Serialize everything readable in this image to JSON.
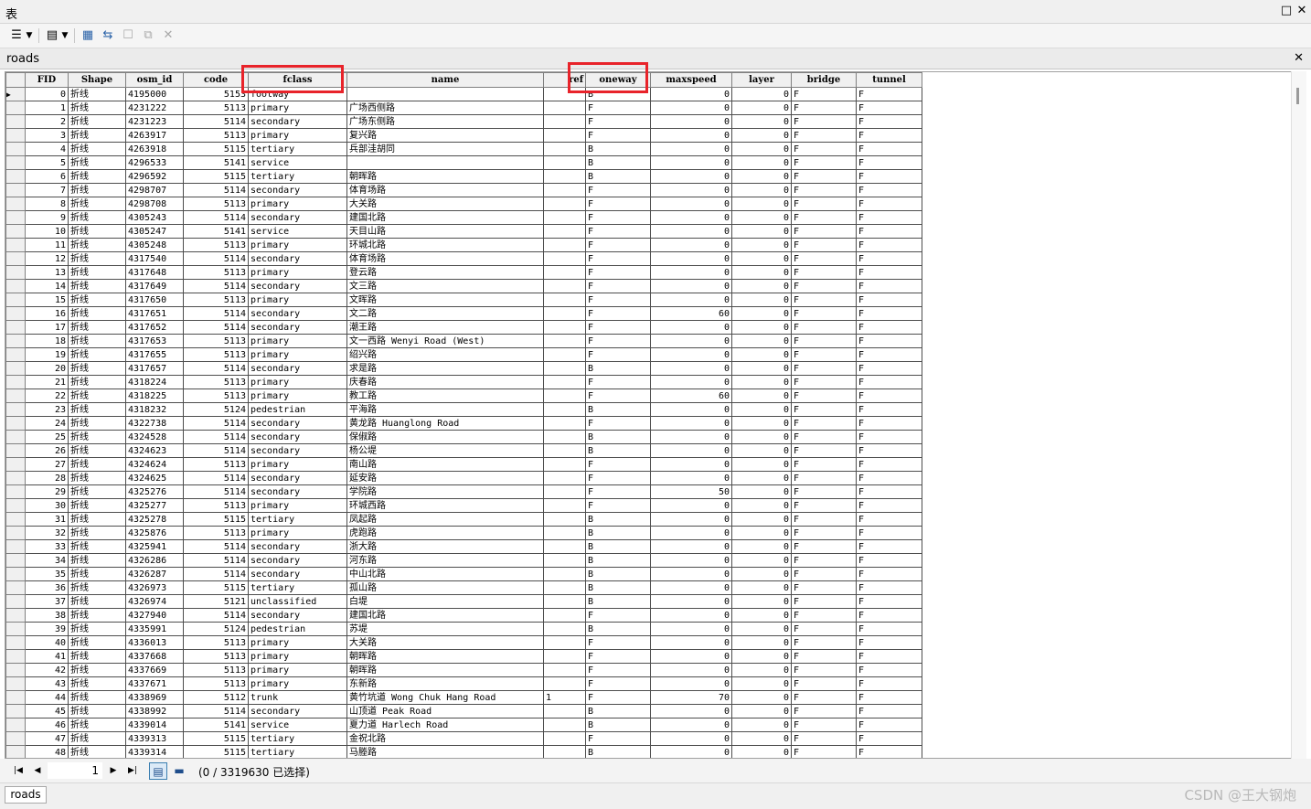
{
  "window": {
    "title": "表",
    "maximize_glyph": "□",
    "close_glyph": "✕"
  },
  "toolbar": {
    "icons": [
      "table-options-icon",
      "related-tables-icon",
      "select-by-attributes-icon",
      "switch-selection-icon",
      "clear-selection-icon",
      "zoom-to-selected-icon",
      "delete-selected-icon"
    ]
  },
  "table_tab": {
    "label": "roads",
    "close_glyph": "✕"
  },
  "columns": [
    "FID",
    "Shape",
    "osm_id",
    "code",
    "fclass",
    "name",
    "ref",
    "oneway",
    "maxspeed",
    "layer",
    "bridge",
    "tunnel"
  ],
  "rows": [
    [
      "0",
      "折线",
      "4195000",
      "5153",
      "footway",
      "",
      "",
      "B",
      "0",
      "0",
      "F",
      "F"
    ],
    [
      "1",
      "折线",
      "4231222",
      "5113",
      "primary",
      "广场西侧路",
      "",
      "F",
      "0",
      "0",
      "F",
      "F"
    ],
    [
      "2",
      "折线",
      "4231223",
      "5114",
      "secondary",
      "广场东侧路",
      "",
      "F",
      "0",
      "0",
      "F",
      "F"
    ],
    [
      "3",
      "折线",
      "4263917",
      "5113",
      "primary",
      "复兴路",
      "",
      "F",
      "0",
      "0",
      "F",
      "F"
    ],
    [
      "4",
      "折线",
      "4263918",
      "5115",
      "tertiary",
      "兵部洼胡同",
      "",
      "B",
      "0",
      "0",
      "F",
      "F"
    ],
    [
      "5",
      "折线",
      "4296533",
      "5141",
      "service",
      "",
      "",
      "B",
      "0",
      "0",
      "F",
      "F"
    ],
    [
      "6",
      "折线",
      "4296592",
      "5115",
      "tertiary",
      "朝晖路",
      "",
      "B",
      "0",
      "0",
      "F",
      "F"
    ],
    [
      "7",
      "折线",
      "4298707",
      "5114",
      "secondary",
      "体育场路",
      "",
      "F",
      "0",
      "0",
      "F",
      "F"
    ],
    [
      "8",
      "折线",
      "4298708",
      "5113",
      "primary",
      "大关路",
      "",
      "F",
      "0",
      "0",
      "F",
      "F"
    ],
    [
      "9",
      "折线",
      "4305243",
      "5114",
      "secondary",
      "建国北路",
      "",
      "F",
      "0",
      "0",
      "F",
      "F"
    ],
    [
      "10",
      "折线",
      "4305247",
      "5141",
      "service",
      "天目山路",
      "",
      "F",
      "0",
      "0",
      "F",
      "F"
    ],
    [
      "11",
      "折线",
      "4305248",
      "5113",
      "primary",
      "环城北路",
      "",
      "F",
      "0",
      "0",
      "F",
      "F"
    ],
    [
      "12",
      "折线",
      "4317540",
      "5114",
      "secondary",
      "体育场路",
      "",
      "F",
      "0",
      "0",
      "F",
      "F"
    ],
    [
      "13",
      "折线",
      "4317648",
      "5113",
      "primary",
      "登云路",
      "",
      "F",
      "0",
      "0",
      "F",
      "F"
    ],
    [
      "14",
      "折线",
      "4317649",
      "5114",
      "secondary",
      "文三路",
      "",
      "F",
      "0",
      "0",
      "F",
      "F"
    ],
    [
      "15",
      "折线",
      "4317650",
      "5113",
      "primary",
      "文晖路",
      "",
      "F",
      "0",
      "0",
      "F",
      "F"
    ],
    [
      "16",
      "折线",
      "4317651",
      "5114",
      "secondary",
      "文二路",
      "",
      "F",
      "60",
      "0",
      "F",
      "F"
    ],
    [
      "17",
      "折线",
      "4317652",
      "5114",
      "secondary",
      "潮王路",
      "",
      "F",
      "0",
      "0",
      "F",
      "F"
    ],
    [
      "18",
      "折线",
      "4317653",
      "5113",
      "primary",
      "文一西路 Wenyi Road (West)",
      "",
      "F",
      "0",
      "0",
      "F",
      "F"
    ],
    [
      "19",
      "折线",
      "4317655",
      "5113",
      "primary",
      "绍兴路",
      "",
      "F",
      "0",
      "0",
      "F",
      "F"
    ],
    [
      "20",
      "折线",
      "4317657",
      "5114",
      "secondary",
      "求是路",
      "",
      "B",
      "0",
      "0",
      "F",
      "F"
    ],
    [
      "21",
      "折线",
      "4318224",
      "5113",
      "primary",
      "庆春路",
      "",
      "F",
      "0",
      "0",
      "F",
      "F"
    ],
    [
      "22",
      "折线",
      "4318225",
      "5113",
      "primary",
      "教工路",
      "",
      "F",
      "60",
      "0",
      "F",
      "F"
    ],
    [
      "23",
      "折线",
      "4318232",
      "5124",
      "pedestrian",
      "平海路",
      "",
      "B",
      "0",
      "0",
      "F",
      "F"
    ],
    [
      "24",
      "折线",
      "4322738",
      "5114",
      "secondary",
      "黄龙路 Huanglong Road",
      "",
      "F",
      "0",
      "0",
      "F",
      "F"
    ],
    [
      "25",
      "折线",
      "4324528",
      "5114",
      "secondary",
      "保俶路",
      "",
      "B",
      "0",
      "0",
      "F",
      "F"
    ],
    [
      "26",
      "折线",
      "4324623",
      "5114",
      "secondary",
      "杨公堤",
      "",
      "B",
      "0",
      "0",
      "F",
      "F"
    ],
    [
      "27",
      "折线",
      "4324624",
      "5113",
      "primary",
      "南山路",
      "",
      "F",
      "0",
      "0",
      "F",
      "F"
    ],
    [
      "28",
      "折线",
      "4324625",
      "5114",
      "secondary",
      "延安路",
      "",
      "F",
      "0",
      "0",
      "F",
      "F"
    ],
    [
      "29",
      "折线",
      "4325276",
      "5114",
      "secondary",
      "学院路",
      "",
      "F",
      "50",
      "0",
      "F",
      "F"
    ],
    [
      "30",
      "折线",
      "4325277",
      "5113",
      "primary",
      "环城西路",
      "",
      "F",
      "0",
      "0",
      "F",
      "F"
    ],
    [
      "31",
      "折线",
      "4325278",
      "5115",
      "tertiary",
      "凤起路",
      "",
      "B",
      "0",
      "0",
      "F",
      "F"
    ],
    [
      "32",
      "折线",
      "4325876",
      "5113",
      "primary",
      "虎跑路",
      "",
      "B",
      "0",
      "0",
      "F",
      "F"
    ],
    [
      "33",
      "折线",
      "4325941",
      "5114",
      "secondary",
      "浙大路",
      "",
      "B",
      "0",
      "0",
      "F",
      "F"
    ],
    [
      "34",
      "折线",
      "4326286",
      "5114",
      "secondary",
      "河东路",
      "",
      "B",
      "0",
      "0",
      "F",
      "F"
    ],
    [
      "35",
      "折线",
      "4326287",
      "5114",
      "secondary",
      "中山北路",
      "",
      "B",
      "0",
      "0",
      "F",
      "F"
    ],
    [
      "36",
      "折线",
      "4326973",
      "5115",
      "tertiary",
      "孤山路",
      "",
      "B",
      "0",
      "0",
      "F",
      "F"
    ],
    [
      "37",
      "折线",
      "4326974",
      "5121",
      "unclassified",
      "白堤",
      "",
      "B",
      "0",
      "0",
      "F",
      "F"
    ],
    [
      "38",
      "折线",
      "4327940",
      "5114",
      "secondary",
      "建国北路",
      "",
      "F",
      "0",
      "0",
      "F",
      "F"
    ],
    [
      "39",
      "折线",
      "4335991",
      "5124",
      "pedestrian",
      "苏堤",
      "",
      "B",
      "0",
      "0",
      "F",
      "F"
    ],
    [
      "40",
      "折线",
      "4336013",
      "5113",
      "primary",
      "大关路",
      "",
      "F",
      "0",
      "0",
      "F",
      "F"
    ],
    [
      "41",
      "折线",
      "4337668",
      "5113",
      "primary",
      "朝晖路",
      "",
      "F",
      "0",
      "0",
      "F",
      "F"
    ],
    [
      "42",
      "折线",
      "4337669",
      "5113",
      "primary",
      "朝晖路",
      "",
      "F",
      "0",
      "0",
      "F",
      "F"
    ],
    [
      "43",
      "折线",
      "4337671",
      "5113",
      "primary",
      "东新路",
      "",
      "F",
      "0",
      "0",
      "F",
      "F"
    ],
    [
      "44",
      "折线",
      "4338969",
      "5112",
      "trunk",
      "黄竹坑道 Wong Chuk Hang Road",
      "1",
      "F",
      "70",
      "0",
      "F",
      "F"
    ],
    [
      "45",
      "折线",
      "4338992",
      "5114",
      "secondary",
      "山顶道 Peak Road",
      "",
      "B",
      "0",
      "0",
      "F",
      "F"
    ],
    [
      "46",
      "折线",
      "4339014",
      "5141",
      "service",
      "夏力道 Harlech Road",
      "",
      "B",
      "0",
      "0",
      "F",
      "F"
    ],
    [
      "47",
      "折线",
      "4339313",
      "5115",
      "tertiary",
      "金祝北路",
      "",
      "F",
      "0",
      "0",
      "F",
      "F"
    ],
    [
      "48",
      "折线",
      "4339314",
      "5115",
      "tertiary",
      "马塍路",
      "",
      "B",
      "0",
      "0",
      "F",
      "F"
    ]
  ],
  "highlighted_columns": [
    "fclass",
    "oneway"
  ],
  "highlight_color": "#e8232a",
  "navigation": {
    "current_page": "1",
    "selection_text": "(0 / 3319630 已选择)"
  },
  "bottom_tab": {
    "label": "roads"
  },
  "watermark": "CSDN @王大钢炮"
}
